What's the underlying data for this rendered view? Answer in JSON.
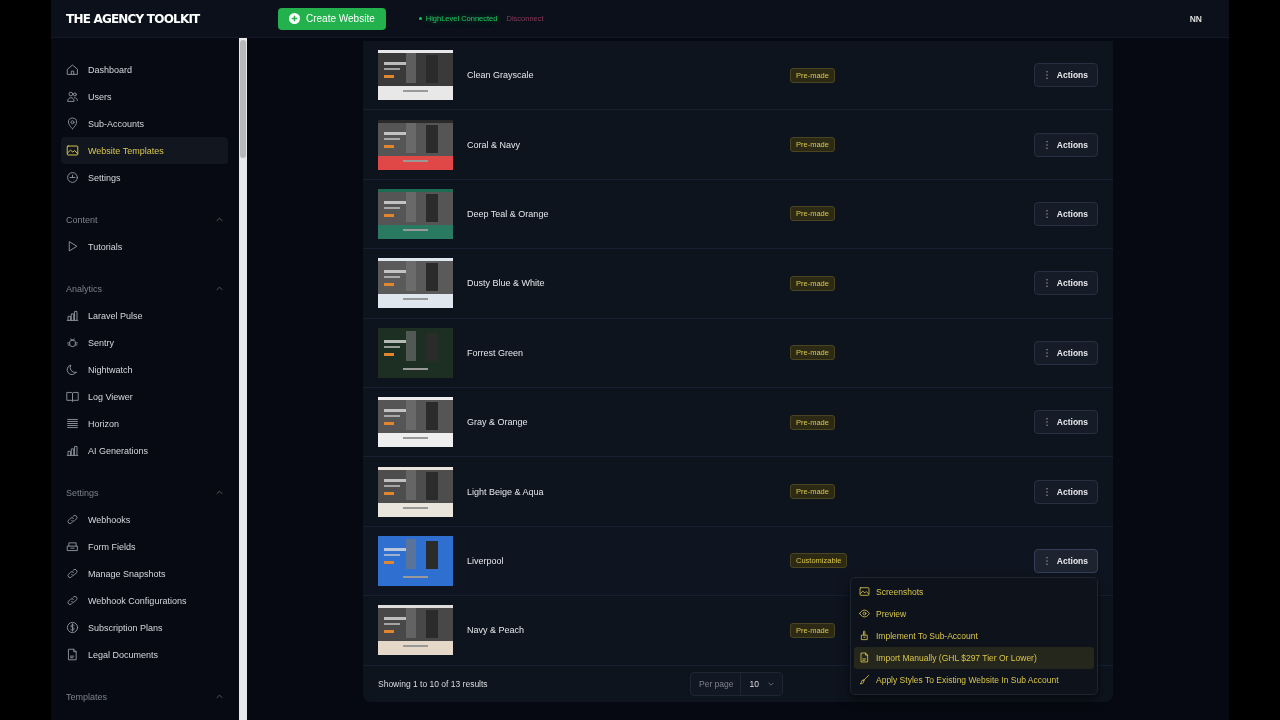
{
  "header": {
    "logo": "THE AGENCY TOOLKIT",
    "create_button": "Create Website",
    "connection": {
      "status": "HighLevel Connected",
      "connected": true
    },
    "disconnect": "Disconnect",
    "avatar": "NN"
  },
  "sidebar": {
    "items": [
      {
        "label": "Dashboard",
        "selected": false
      },
      {
        "label": "Users",
        "selected": false
      },
      {
        "label": "Sub-Accounts",
        "selected": false
      },
      {
        "label": "Website Templates",
        "selected": true
      },
      {
        "label": "Settings",
        "selected": false
      }
    ],
    "groups": [
      {
        "title": "Content",
        "expanded": true,
        "items": [
          {
            "label": "Tutorials",
            "selected": false
          }
        ]
      },
      {
        "title": "Analytics",
        "expanded": true,
        "items": [
          {
            "label": "Laravel Pulse",
            "selected": false
          },
          {
            "label": "Sentry",
            "selected": false
          },
          {
            "label": "Nightwatch",
            "selected": false
          },
          {
            "label": "Log Viewer",
            "selected": false
          },
          {
            "label": "Horizon",
            "selected": false
          },
          {
            "label": "AI Generations",
            "selected": false
          }
        ]
      },
      {
        "title": "Settings",
        "expanded": true,
        "items": [
          {
            "label": "Webhooks",
            "selected": false
          },
          {
            "label": "Form Fields",
            "selected": false
          },
          {
            "label": "Manage Snapshots",
            "selected": false
          },
          {
            "label": "Webhook Configurations",
            "selected": false
          },
          {
            "label": "Subscription Plans",
            "selected": false
          },
          {
            "label": "Legal Documents",
            "selected": false
          }
        ]
      },
      {
        "title": "Templates",
        "expanded": true
      }
    ]
  },
  "table": {
    "rows": [
      {
        "name": "Clean Grayscale",
        "badge": "Pre-made",
        "actions": "Actions",
        "menu_open": false
      },
      {
        "name": "Coral & Navy",
        "badge": "Pre-made",
        "actions": "Actions",
        "menu_open": false
      },
      {
        "name": "Deep Teal & Orange",
        "badge": "Pre-made",
        "actions": "Actions",
        "menu_open": false
      },
      {
        "name": "Dusty Blue & White",
        "badge": "Pre-made",
        "actions": "Actions",
        "menu_open": false
      },
      {
        "name": "Forrest Green",
        "badge": "Pre-made",
        "actions": "Actions",
        "menu_open": false
      },
      {
        "name": "Gray & Orange",
        "badge": "Pre-made",
        "actions": "Actions",
        "menu_open": false
      },
      {
        "name": "Light Beige & Aqua",
        "badge": "Pre-made",
        "actions": "Actions",
        "menu_open": false
      },
      {
        "name": "Liverpool",
        "badge": "Customizable",
        "actions": "Actions",
        "menu_open": true
      },
      {
        "name": "Navy & Peach",
        "badge": "Pre-made",
        "menu_open": false
      }
    ],
    "footer": {
      "summary": "Showing 1 to 10 of 13 results",
      "per_page_label": "Per page",
      "per_page": "10"
    }
  },
  "actions_menu": {
    "items": [
      {
        "label": "Screenshots",
        "hovered": false
      },
      {
        "label": "Preview",
        "hovered": false
      },
      {
        "label": "Implement To Sub-Account",
        "hovered": false
      },
      {
        "label": "Import Manually (GHL $297 Tier Or Lower)",
        "hovered": true
      },
      {
        "label": "Apply Styles To Existing Website In Sub Account",
        "hovered": false
      }
    ]
  }
}
